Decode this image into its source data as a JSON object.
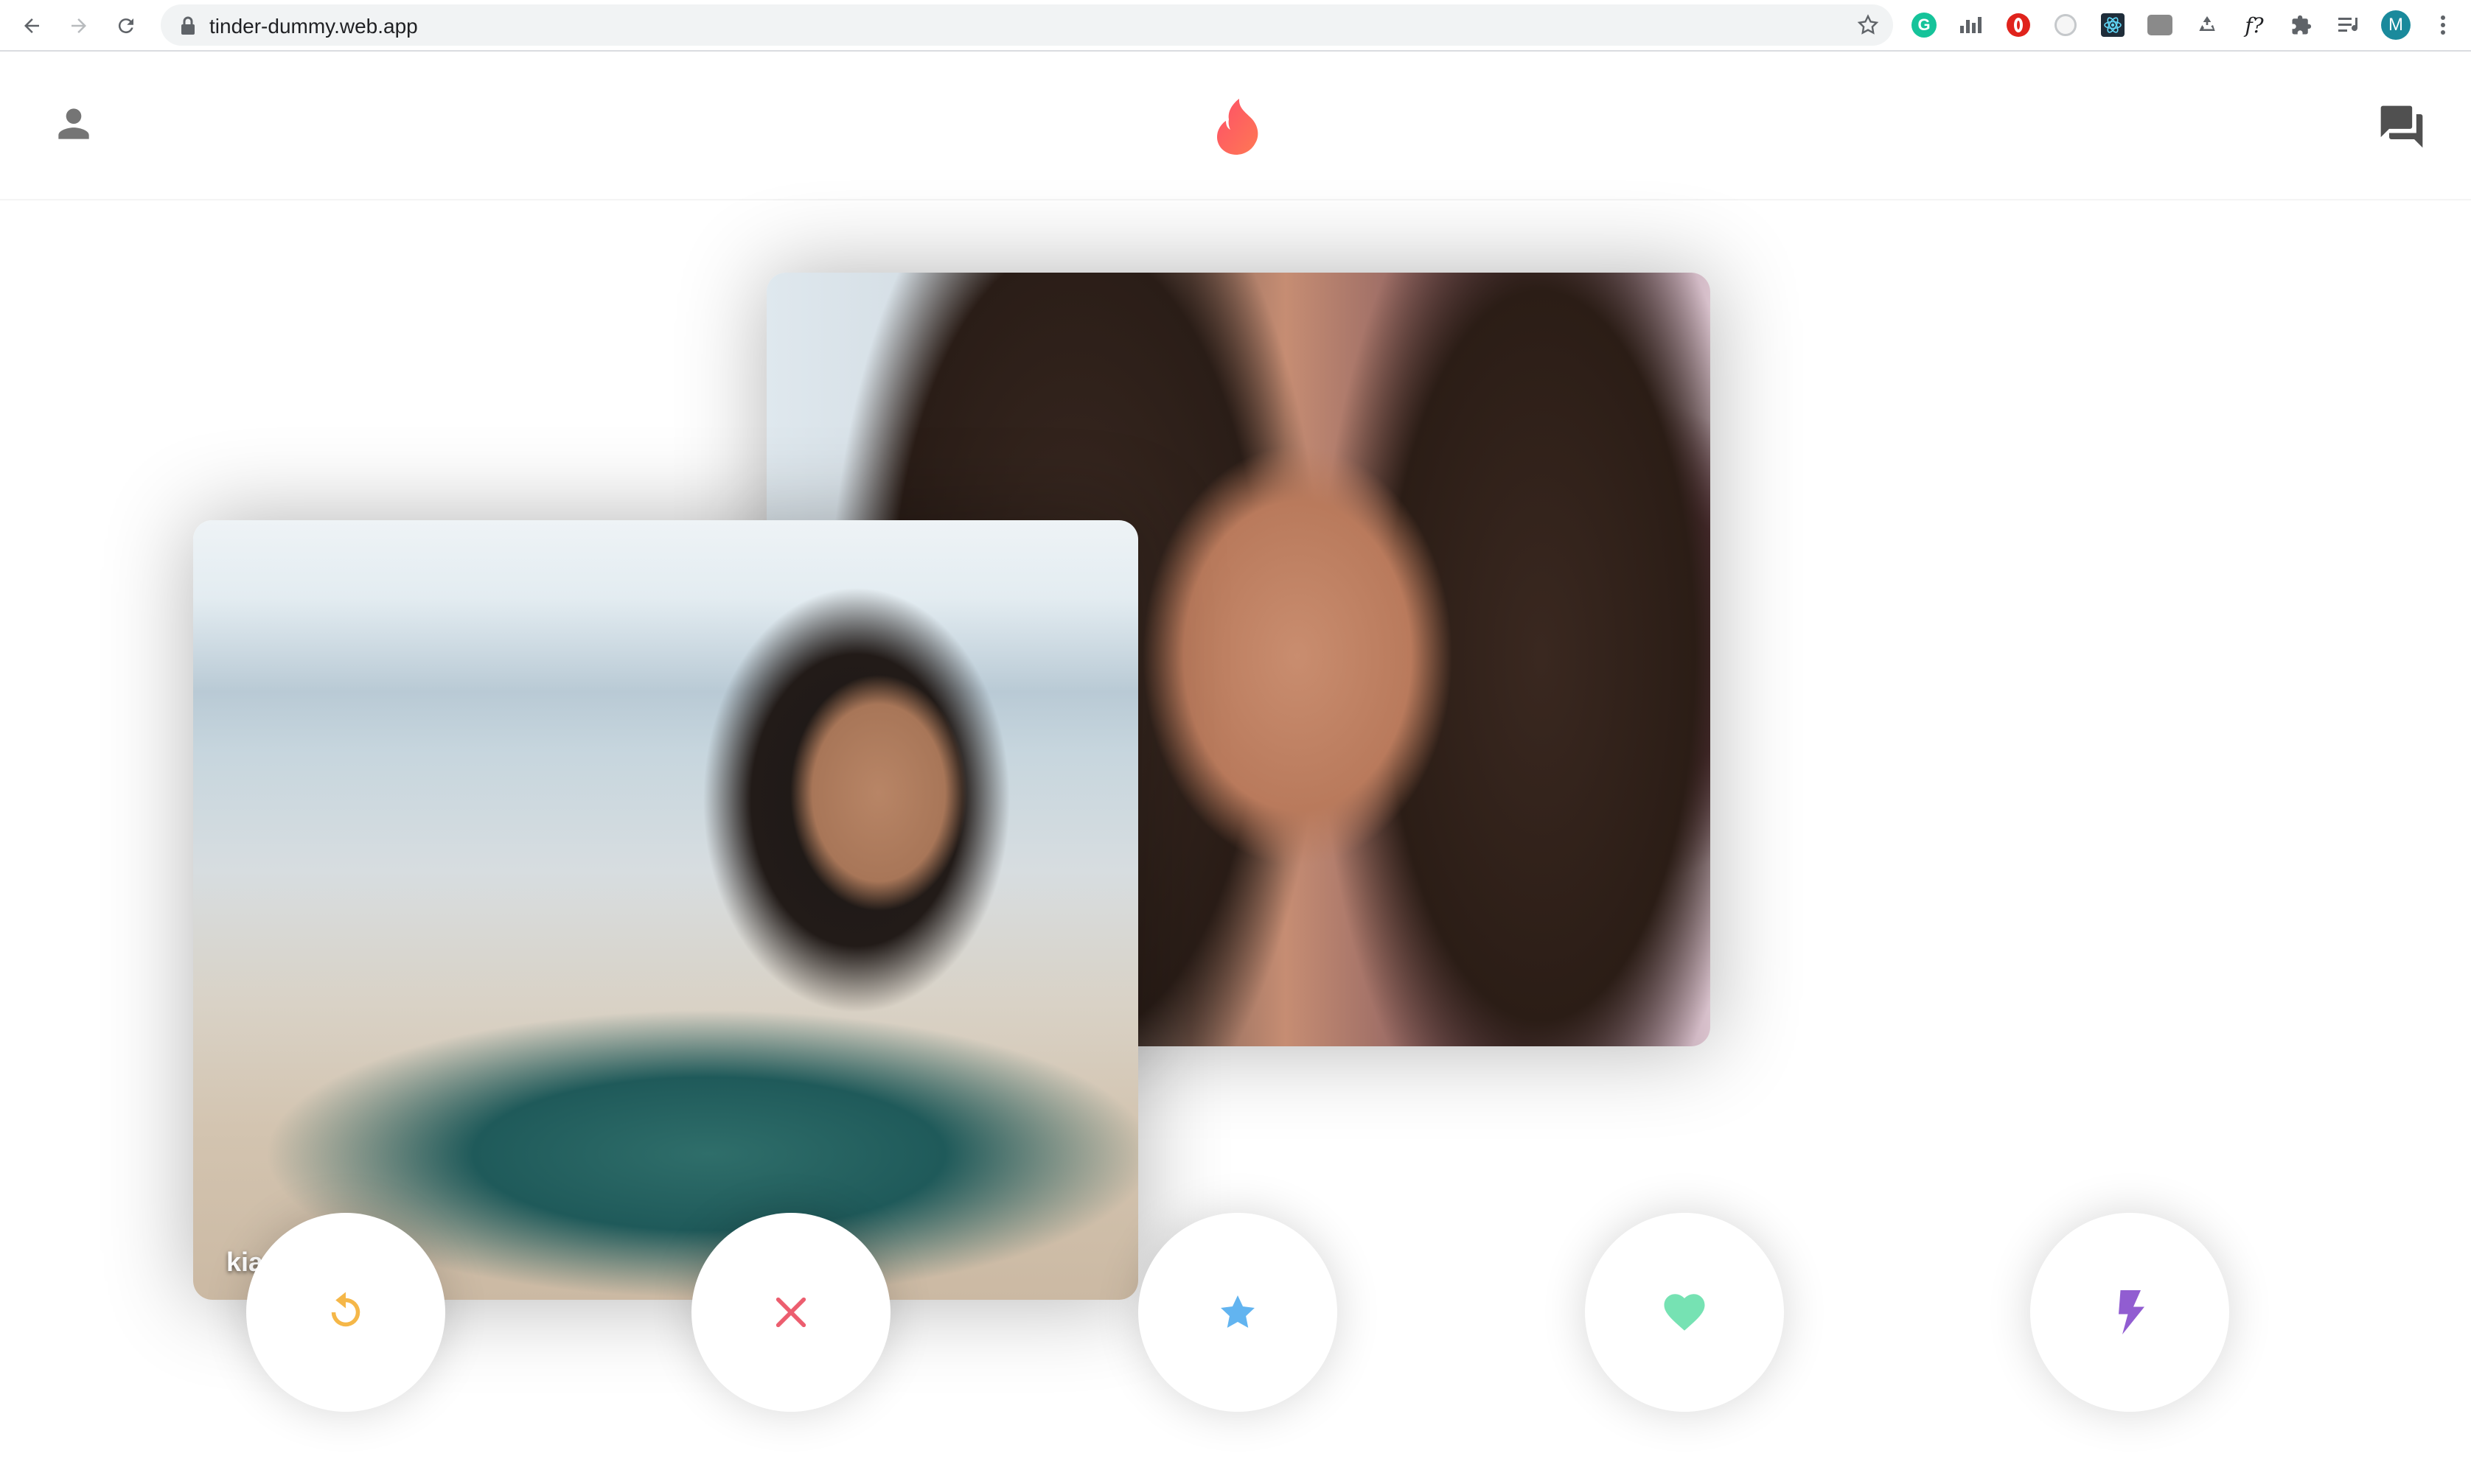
{
  "browser": {
    "url": "tinder-dummy.web.app",
    "icons": {
      "back": "arrow-left-icon",
      "forward": "arrow-right-icon",
      "reload": "reload-icon",
      "lock": "lock-icon",
      "bookmark": "star-outline-icon"
    },
    "extensions": [
      {
        "name": "grammarly-icon",
        "color": "#15c39a",
        "label": "G"
      },
      {
        "name": "analytics-icon",
        "color": "#5f6368"
      },
      {
        "name": "opera-icon",
        "color": "#e0231c"
      },
      {
        "name": "timer-icon",
        "color": "#9aa0a6"
      },
      {
        "name": "react-devtools-icon",
        "color": "#2c3e50"
      },
      {
        "name": "screen-capture-icon",
        "color": "#7d7d7d"
      },
      {
        "name": "recycle-icon",
        "color": "#5f6368"
      },
      {
        "name": "whatfont-icon",
        "color": "#202124",
        "label": "f?"
      },
      {
        "name": "puzzle-icon",
        "color": "#5f6368"
      },
      {
        "name": "media-queue-icon",
        "color": "#5f6368"
      }
    ],
    "profile_initial": "M",
    "profile_color": "#1a8a9c"
  },
  "header": {
    "profile_icon": "person-icon",
    "logo_icon": "tinder-flame-icon",
    "chat_icon": "forum-icon",
    "logo_color": "#fd5068"
  },
  "cards": [
    {
      "name": "",
      "position": "back"
    },
    {
      "name": "kia",
      "position": "front"
    }
  ],
  "swipe_buttons": [
    {
      "name": "rewind-button",
      "icon": "replay-icon",
      "color": "#f5b748"
    },
    {
      "name": "nope-button",
      "icon": "close-icon",
      "color": "#ec5e6f"
    },
    {
      "name": "super-like-button",
      "icon": "star-icon",
      "color": "#62b4f0"
    },
    {
      "name": "like-button",
      "icon": "heart-icon",
      "color": "#76e2b3"
    },
    {
      "name": "boost-button",
      "icon": "bolt-icon",
      "color": "#915dd1"
    }
  ]
}
